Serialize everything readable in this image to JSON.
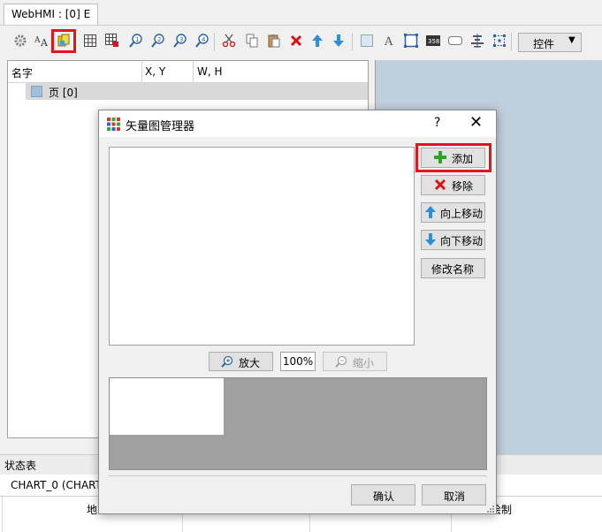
{
  "tab": {
    "label": "WebHMI : [0] E"
  },
  "toolbar": {
    "controls_label": "控件"
  },
  "tree": {
    "columns": [
      "名字",
      "X, Y",
      "W, H"
    ],
    "row_label": "页 [0]"
  },
  "status": {
    "title": "状态表",
    "tab_label": "CHART_0 (CHART",
    "col_partial_left": "地",
    "col_partial_right": "绘制"
  },
  "dialog": {
    "title": "矢量图管理器",
    "help": "?",
    "close": "✕",
    "buttons": {
      "add": "添加",
      "remove": "移除",
      "move_up": "向上移动",
      "move_down": "向下移动",
      "rename": "修改名称",
      "zoom_in": "放大",
      "zoom_out": "缩小",
      "ok": "确认",
      "cancel": "取消"
    },
    "zoom_value": "100%"
  },
  "colors": {
    "highlight": "#e0151f",
    "canvas_bg": "#bfcfdc",
    "preview_bg": "#a0a0a0"
  }
}
